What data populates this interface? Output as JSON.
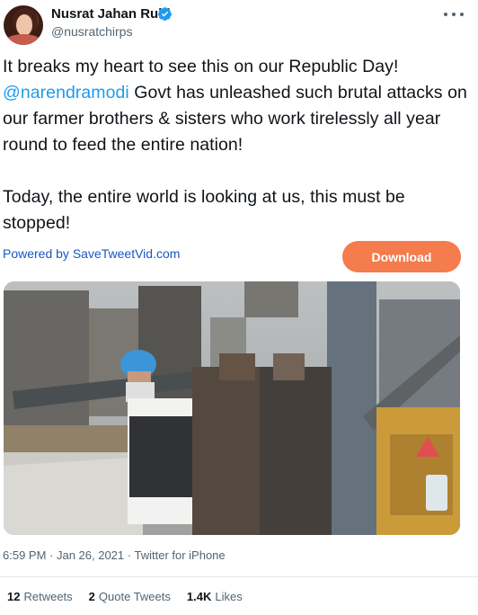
{
  "tweet": {
    "author_name": "Nusrat Jahan Ruhi",
    "handle": "@nusratchirps",
    "more_label": "More",
    "text_line1": "It breaks my heart to see this on our Republic Day!",
    "mention": "@narendramodi",
    "text_line2_rest": " Govt has unleashed such brutal attacks on our farmer brothers & sisters who work tirelessly all year round to feed the entire nation!",
    "text_para2": "Today, the entire world is looking at us, this must be stopped!",
    "timestamp": "6:59 PM · Jan 26, 2021",
    "source": "Twitter for iPhone",
    "meta_separator": " · "
  },
  "download_bar": {
    "powered_label": "Powered by SaveTweetVid.com",
    "download_label": "Download"
  },
  "stats": [
    {
      "count": "12",
      "label": "Retweets"
    },
    {
      "count": "2",
      "label": "Quote Tweets"
    },
    {
      "count": "1.4K",
      "label": "Likes"
    }
  ],
  "icons": {
    "verified": "verified-badge-icon",
    "more": "more-horizontal-icon"
  },
  "colors": {
    "accent": "#1d9bf0",
    "download_button": "#f47c4d",
    "powered_link": "#1a56c5",
    "secondary_text": "#536471"
  }
}
